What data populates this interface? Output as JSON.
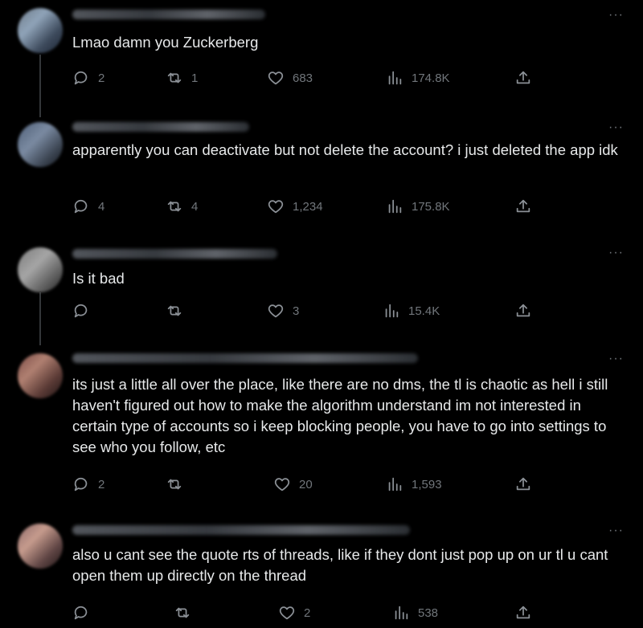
{
  "more_label": "···",
  "tweets": [
    {
      "text": "Lmao damn you Zuckerberg",
      "replies": "2",
      "retweets": "1",
      "likes": "683",
      "views": "174.8K"
    },
    {
      "text": "apparently you can deactivate but not delete the account? i just deleted the app idk",
      "replies": "4",
      "retweets": "4",
      "likes": "1,234",
      "views": "175.8K"
    },
    {
      "text": "Is it bad",
      "replies": "",
      "retweets": "",
      "likes": "3",
      "views": "15.4K"
    },
    {
      "text": "its just a little all over the place, like there are no dms, the tl is chaotic as hell i still haven't figured out how to make the algorithm understand im not interested in certain type of accounts so i keep blocking people, you have to go into settings to see who you follow, etc",
      "replies": "2",
      "retweets": "",
      "likes": "20",
      "views": "1,593"
    },
    {
      "text": "also u cant see the quote rts of threads, like if they dont just pop up on ur tl u cant open them up directly on the thread",
      "replies": "",
      "retweets": "",
      "likes": "2",
      "views": "538"
    }
  ],
  "icons": {
    "reply": "reply-icon",
    "retweet": "retweet-icon",
    "like": "heart-icon",
    "views": "views-icon",
    "share": "share-icon",
    "more": "more-icon"
  }
}
